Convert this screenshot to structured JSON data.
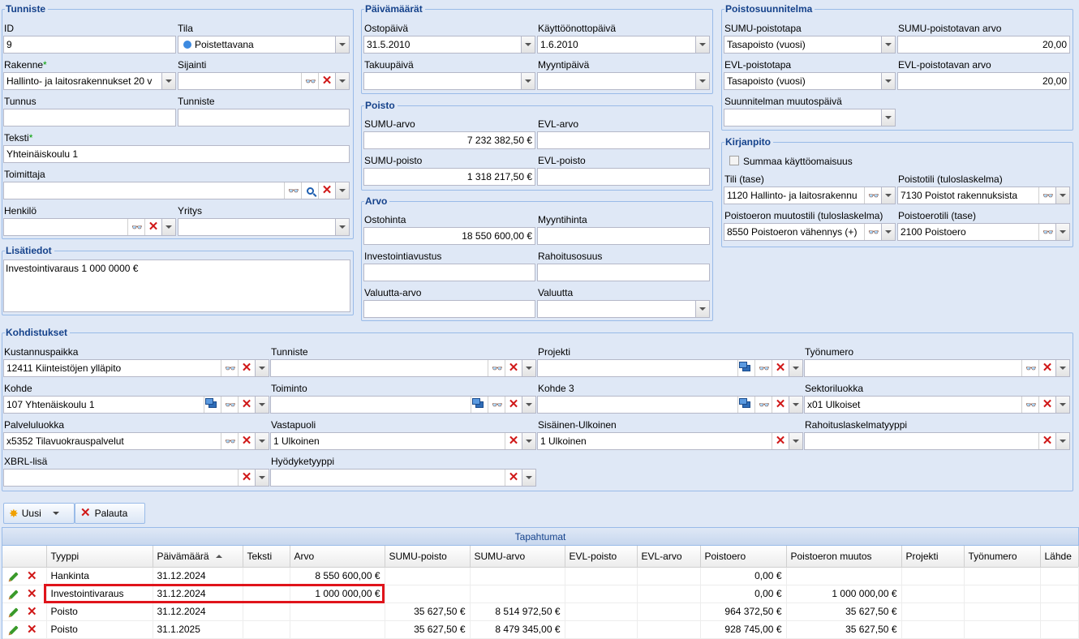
{
  "tunniste": {
    "legend": "Tunniste",
    "id_label": "ID",
    "id_value": "9",
    "tila_label": "Tila",
    "tila_value": "Poistettavana",
    "rakenne_label": "Rakenne",
    "rakenne_value": "Hallinto- ja laitosrakennukset 20 v",
    "sijainti_label": "Sijainti",
    "sijainti_value": "",
    "tunnus_label": "Tunnus",
    "tunnus_value": "",
    "tunniste_label": "Tunniste",
    "tunniste_value": "",
    "teksti_label": "Teksti",
    "teksti_value": "Yhteinäiskoulu 1",
    "toimittaja_label": "Toimittaja",
    "toimittaja_value": "",
    "henkilo_label": "Henkilö",
    "henkilo_value": "",
    "yritys_label": "Yritys",
    "yritys_value": ""
  },
  "lisatiedot": {
    "legend": "Lisätiedot",
    "text": "Investointivaraus 1 000 0000 €"
  },
  "paivamaarat": {
    "legend": "Päivämäärät",
    "ostopaiva_label": "Ostopäivä",
    "ostopaiva_value": "31.5.2010",
    "kayttoonotto_label": "Käyttöönottopäivä",
    "kayttoonotto_value": "1.6.2010",
    "takuupaiva_label": "Takuupäivä",
    "takuupaiva_value": "",
    "myyntipaiva_label": "Myyntipäivä",
    "myyntipaiva_value": ""
  },
  "poisto": {
    "legend": "Poisto",
    "sumu_arvo_label": "SUMU-arvo",
    "sumu_arvo_value": "7 232 382,50 €",
    "evl_arvo_label": "EVL-arvo",
    "evl_arvo_value": "",
    "sumu_poisto_label": "SUMU-poisto",
    "sumu_poisto_value": "1 318 217,50 €",
    "evl_poisto_label": "EVL-poisto",
    "evl_poisto_value": ""
  },
  "arvo": {
    "legend": "Arvo",
    "ostohinta_label": "Ostohinta",
    "ostohinta_value": "18 550 600,00 €",
    "myyntihinta_label": "Myyntihinta",
    "myyntihinta_value": "",
    "investointiavustus_label": "Investointiavustus",
    "investointiavustus_value": "",
    "rahoitusosuus_label": "Rahoitusosuus",
    "rahoitusosuus_value": "",
    "valuutta_arvo_label": "Valuutta-arvo",
    "valuutta_arvo_value": "",
    "valuutta_label": "Valuutta",
    "valuutta_value": ""
  },
  "poistosuunnitelma": {
    "legend": "Poistosuunnitelma",
    "sumu_poistotapa_label": "SUMU-poistotapa",
    "sumu_poistotapa_value": "Tasapoisto (vuosi)",
    "sumu_poistotavan_arvo_label": "SUMU-poistotavan arvo",
    "sumu_poistotavan_arvo_value": "20,00",
    "evl_poistotapa_label": "EVL-poistotapa",
    "evl_poistotapa_value": "Tasapoisto (vuosi)",
    "evl_poistotavan_arvo_label": "EVL-poistotavan arvo",
    "evl_poistotavan_arvo_value": "20,00",
    "muutospaiva_label": "Suunnitelman muutospäivä",
    "muutospaiva_value": ""
  },
  "kirjanpito": {
    "legend": "Kirjanpito",
    "summaa_label": "Summaa käyttöomaisuus",
    "tili_label": "Tili (tase)",
    "tili_value": "1120 Hallinto- ja laitosrakennu",
    "poistotili_label": "Poistotili (tuloslaskelma)",
    "poistotili_value": "7130 Poistot rakennuksista",
    "muutostili_label": "Poistoeron muutostili (tuloslaskelma)",
    "muutostili_value": "8550 Poistoeron vähennys (+)",
    "poistoerotili_label": "Poistoerotili (tase)",
    "poistoerotili_value": "2100 Poistoero"
  },
  "kohdistukset": {
    "legend": "Kohdistukset",
    "kustannuspaikka_label": "Kustannuspaikka",
    "kustannuspaikka_value": "12411 Kiinteistöjen ylläpito",
    "tunniste_label": "Tunniste",
    "tunniste_value": "",
    "projekti_label": "Projekti",
    "projekti_value": "",
    "tyonumero_label": "Työnumero",
    "tyonumero_value": "",
    "kohde_label": "Kohde",
    "kohde_value": "107 Yhtenäiskoulu 1",
    "toiminto_label": "Toiminto",
    "toiminto_value": "",
    "kohde3_label": "Kohde 3",
    "kohde3_value": "",
    "sektoriluokka_label": "Sektoriluokka",
    "sektoriluokka_value": "x01 Ulkoiset",
    "palveluluokka_label": "Palveluluokka",
    "palveluluokka_value": "x5352 Tilavuokrauspalvelut",
    "vastapuoli_label": "Vastapuoli",
    "vastapuoli_value": "1 Ulkoinen",
    "sisainen_label": "Sisäinen-Ulkoinen",
    "sisainen_value": "1 Ulkoinen",
    "rahoituslaskelma_label": "Rahoituslaskelmatyyppi",
    "rahoituslaskelma_value": "",
    "xbrl_label": "XBRL-lisä",
    "xbrl_value": "",
    "hyodyke_label": "Hyödyketyyppi",
    "hyodyke_value": ""
  },
  "toolbar": {
    "uusi_label": "Uusi",
    "palauta_label": "Palauta"
  },
  "grid": {
    "title": "Tapahtumat",
    "columns": [
      "Tyyppi",
      "Päivämäärä",
      "Teksti",
      "Arvo",
      "SUMU-poisto",
      "SUMU-arvo",
      "EVL-poisto",
      "EVL-arvo",
      "Poistoero",
      "Poistoeron muutos",
      "Projekti",
      "Työnumero",
      "Lähde"
    ],
    "rows": [
      [
        "Hankinta",
        "31.12.2024",
        "",
        "8 550 600,00 €",
        "",
        "",
        "",
        "",
        "0,00 €",
        "",
        "",
        "",
        ""
      ],
      [
        "Investointivaraus",
        "31.12.2024",
        "",
        "1 000 000,00 €",
        "",
        "",
        "",
        "",
        "0,00 €",
        "1 000 000,00 €",
        "",
        "",
        ""
      ],
      [
        "Poisto",
        "31.12.2024",
        "",
        "",
        "35 627,50 €",
        "8 514 972,50 €",
        "",
        "",
        "964 372,50 €",
        "35 627,50 €",
        "",
        "",
        ""
      ],
      [
        "Poisto",
        "31.1.2025",
        "",
        "",
        "35 627,50 €",
        "8 479 345,00 €",
        "",
        "",
        "928 745,00 €",
        "35 627,50 €",
        "",
        "",
        ""
      ]
    ]
  },
  "colors": {
    "border": "#99bbe8",
    "legend": "#15428b",
    "background": "#dfe8f6",
    "highlight": "#e0141b"
  }
}
